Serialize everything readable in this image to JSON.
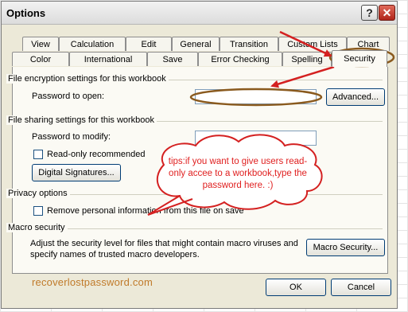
{
  "window": {
    "title": "Options"
  },
  "titlebar": {
    "help_glyph": "?",
    "close_glyph": "✕"
  },
  "tabs": {
    "row1": [
      "View",
      "Calculation",
      "Edit",
      "General",
      "Transition",
      "Custom Lists",
      "Chart"
    ],
    "row2": [
      "Color",
      "International",
      "Save",
      "Error Checking",
      "Spelling",
      "Security"
    ],
    "active": "Security"
  },
  "encryption": {
    "header": "File encryption settings for this workbook",
    "password_open_label": "Password to open:",
    "password_open_value": "",
    "advanced_button": "Advanced..."
  },
  "sharing": {
    "header": "File sharing settings for this workbook",
    "password_modify_label": "Password to modify:",
    "password_modify_value": "",
    "readonly_label": "Read-only recommended",
    "readonly_checked": false,
    "digital_signatures_button": "Digital Signatures..."
  },
  "privacy": {
    "header": "Privacy options",
    "remove_info_label": "Remove personal information from this file on save",
    "remove_info_checked": false
  },
  "macro": {
    "header": "Macro security",
    "description_line1": "Adjust the security level for files that might contain macro viruses and",
    "description_line2": "specify names of trusted macro developers.",
    "macro_security_button": "Macro Security..."
  },
  "footer": {
    "ok_button": "OK",
    "cancel_button": "Cancel"
  },
  "annotations": {
    "tip": "tips:if you want to give users read-only accee to a workbook,type the password here.  :)",
    "watermark": "recoverlostpassword.com",
    "arrow_color": "#d42020",
    "cloud_border_color": "#d42020",
    "ellipse_color": "#8a5a1e"
  }
}
